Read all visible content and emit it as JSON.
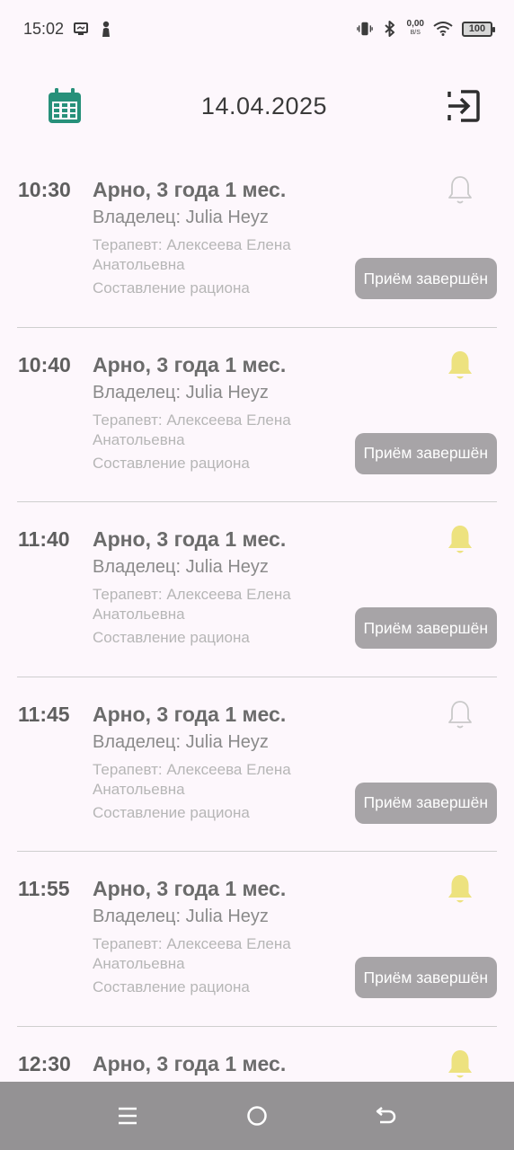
{
  "status_bar": {
    "time": "15:02",
    "net_speed_value": "0,00",
    "net_speed_unit": "B/S",
    "battery": "100",
    "icons": [
      "screen-icon",
      "lock-person-icon",
      "vibrate-icon",
      "bluetooth-icon",
      "wifi-icon",
      "battery-icon"
    ]
  },
  "header": {
    "date": "14.04.2025",
    "calendar_icon": "calendar-icon",
    "logout_icon": "logout-icon"
  },
  "colors": {
    "accent": "#27907a",
    "bell_active": "#ede27f",
    "bell_inactive": "#c9c9c9",
    "done_button": "#a7a4a7",
    "background": "#fdf7fc",
    "nav_bar": "#949294"
  },
  "appointments": [
    {
      "time": "10:30",
      "pet": "Арно, 3 года 1 мес.",
      "owner": "Владелец: Julia Heyz",
      "therapist": "Терапевт: Алексеева Елена Анатольевна",
      "reason": "Составление рациона",
      "status": "Приём завершён",
      "bell": "inactive"
    },
    {
      "time": "10:40",
      "pet": "Арно, 3 года 1 мес.",
      "owner": "Владелец: Julia Heyz",
      "therapist": "Терапевт: Алексеева Елена Анатольевна",
      "reason": "Составление рациона",
      "status": "Приём завершён",
      "bell": "active"
    },
    {
      "time": "11:40",
      "pet": "Арно, 3 года 1 мес.",
      "owner": "Владелец: Julia Heyz",
      "therapist": "Терапевт: Алексеева Елена Анатольевна",
      "reason": "Составление рациона",
      "status": "Приём завершён",
      "bell": "active"
    },
    {
      "time": "11:45",
      "pet": "Арно, 3 года 1 мес.",
      "owner": "Владелец: Julia Heyz",
      "therapist": "Терапевт: Алексеева Елена Анатольевна",
      "reason": "Составление рациона",
      "status": "Приём завершён",
      "bell": "inactive"
    },
    {
      "time": "11:55",
      "pet": "Арно, 3 года 1 мес.",
      "owner": "Владелец: Julia Heyz",
      "therapist": "Терапевт: Алексеева Елена Анатольевна",
      "reason": "Составление рациона",
      "status": "Приём завершён",
      "bell": "active"
    },
    {
      "time": "12:30",
      "pet": "Арно, 3 года 1 мес.",
      "bell": "active"
    }
  ],
  "nav_bar": {
    "icons": [
      "menu-icon",
      "home-icon",
      "back-icon"
    ]
  }
}
